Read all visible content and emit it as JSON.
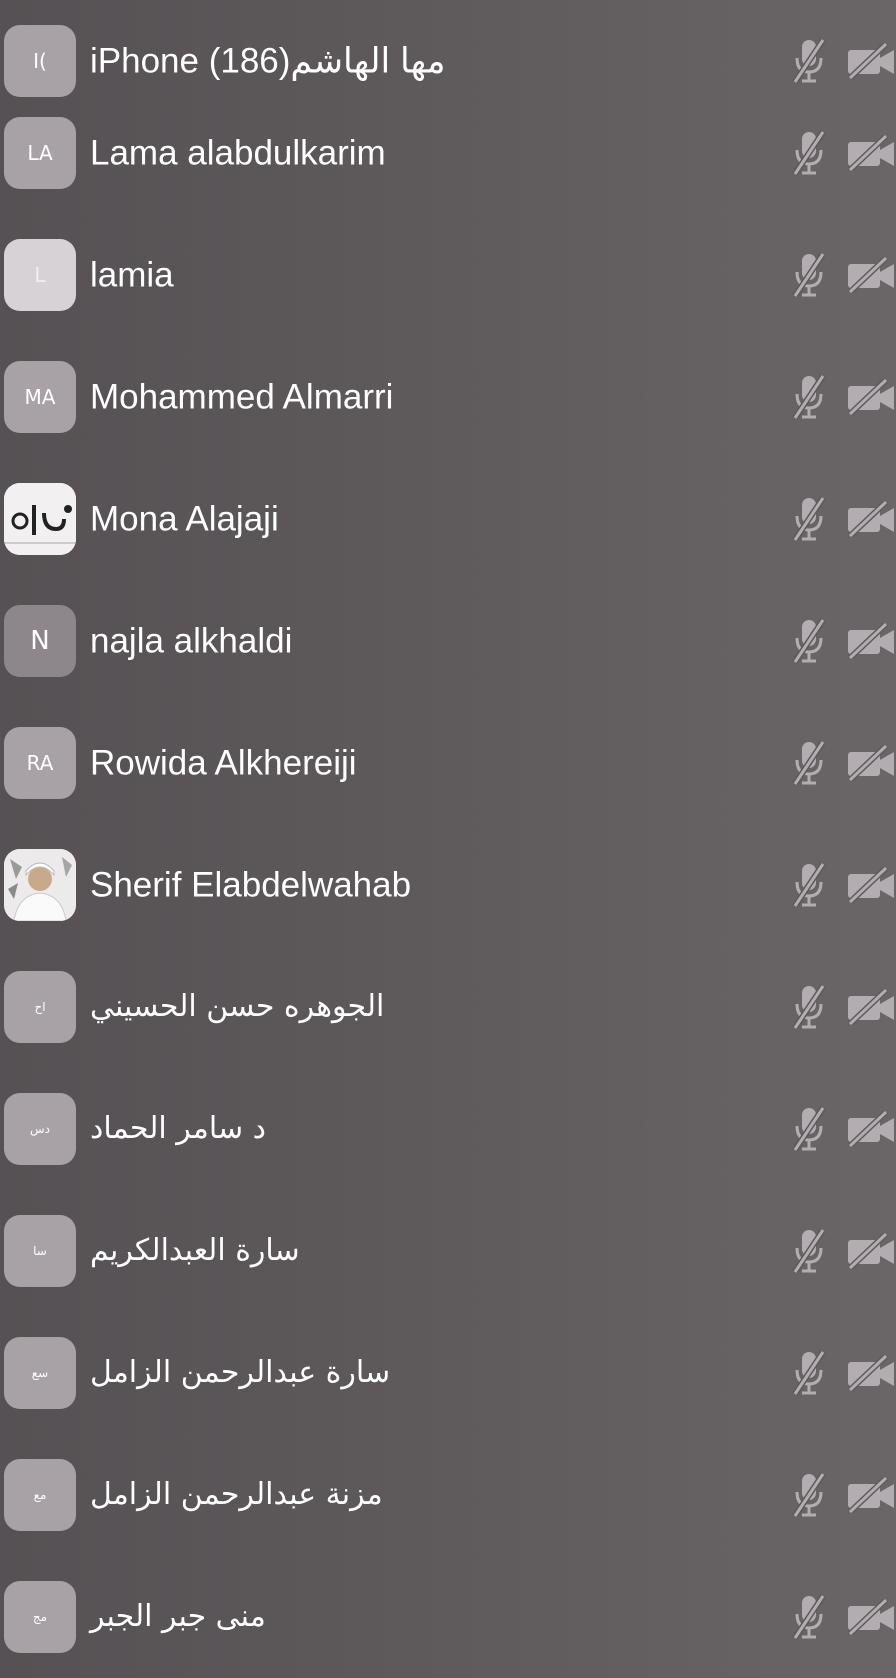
{
  "participants": [
    {
      "name": "iPhone (186)مها الهاشم",
      "initials": "I(",
      "avatar_style": "grey",
      "mic": "muted",
      "video": "off"
    },
    {
      "name": "Lama alabdulkarim",
      "initials": "LA",
      "avatar_style": "grey",
      "mic": "muted",
      "video": "off"
    },
    {
      "name": "lamia",
      "initials": "L",
      "avatar_style": "light",
      "mic": "muted",
      "video": "off"
    },
    {
      "name": "Mohammed Almarri",
      "initials": "MA",
      "avatar_style": "grey",
      "mic": "muted",
      "video": "off"
    },
    {
      "name": "Mona Alajaji",
      "initials": "",
      "avatar_style": "logo-photo",
      "mic": "muted",
      "video": "off"
    },
    {
      "name": "najla alkhaldi",
      "initials": "N",
      "avatar_style": "dark",
      "mic": "muted",
      "video": "off"
    },
    {
      "name": "Rowida Alkhereiji",
      "initials": "RA",
      "avatar_style": "grey",
      "mic": "muted",
      "video": "off"
    },
    {
      "name": "Sherif Elabdelwahab",
      "initials": "",
      "avatar_style": "person-photo",
      "mic": "muted",
      "video": "off"
    },
    {
      "name": "الجوهره حسن الحسيني",
      "initials": "اح",
      "avatar_style": "grey",
      "mic": "muted",
      "video": "off"
    },
    {
      "name": "د سامر الحماد",
      "initials": "دس",
      "avatar_style": "grey",
      "mic": "muted",
      "video": "off"
    },
    {
      "name": "سارة العبدالكريم",
      "initials": "سا",
      "avatar_style": "grey",
      "mic": "muted",
      "video": "off"
    },
    {
      "name": "سارة عبدالرحمن الزامل",
      "initials": "سع",
      "avatar_style": "grey",
      "mic": "muted",
      "video": "off"
    },
    {
      "name": "مزنة عبدالرحمن الزامل",
      "initials": "مع",
      "avatar_style": "grey",
      "mic": "muted",
      "video": "off"
    },
    {
      "name": "منى جبر الجبر",
      "initials": "مج",
      "avatar_style": "grey",
      "mic": "muted",
      "video": "off"
    }
  ],
  "icons": {
    "mic": "muted-microphone-icon",
    "video": "video-off-icon"
  },
  "colors": {
    "background": "#5c5759",
    "text": "#ffffff",
    "avatar": "#a8a2a6",
    "icon": "#b3adb1"
  }
}
